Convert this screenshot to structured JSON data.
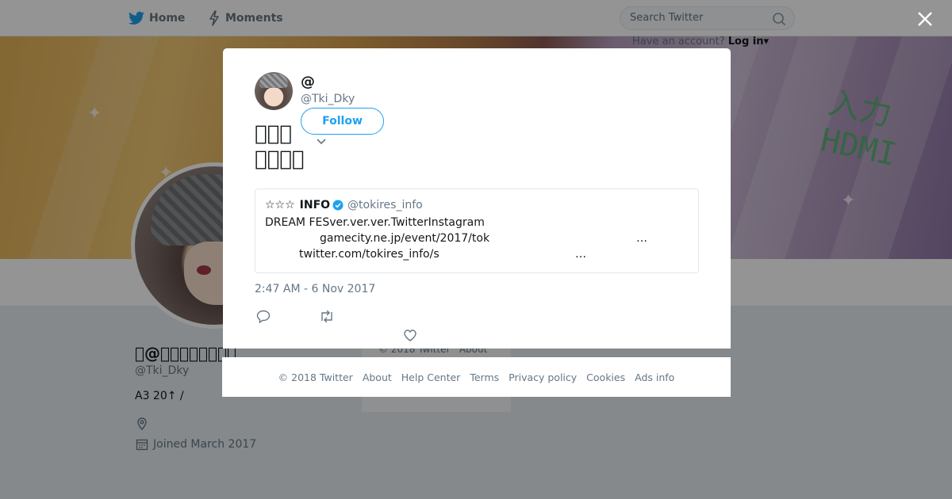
{
  "nav": {
    "home_label": "Home",
    "moments_label": "Moments",
    "search_placeholder": "Search Twitter",
    "login_hint": "Have an account?",
    "login_label": "Log in"
  },
  "banner": {
    "text": "入力\nHDMI"
  },
  "profile": {
    "name": "\u0000@\u0000\u0000\u0000\u0000\u0000\u0000\u0000\u0000",
    "handle": "@Tki_Dky",
    "bio": "A3 20↑ /",
    "joined": "Joined March 2017"
  },
  "sidebar": {
    "footer_copyright": "© 2018 Twitter",
    "footer_about": "About"
  },
  "tweet": {
    "display_name": "@",
    "handle": "@Tki_Dky",
    "follow_label": "Follow",
    "text_line1": "\u0000\u0000\u0000",
    "text_line2": "\u0000\u0000\u0000\u0000",
    "timestamp": "2:47 AM - 6 Nov 2017"
  },
  "quoted": {
    "stars": "☆☆☆",
    "name": "INFO",
    "handle": "@tokires_info",
    "line1": "DREAM FESver.ver.ver.TwitterInstagram",
    "line2": "gamecity.ne.jp/event/2017/tok",
    "line2_ellipsis": "…",
    "line3": "twitter.com/tokires_info/s",
    "line3_ellipsis": "…"
  },
  "footer": {
    "copyright": "© 2018 Twitter",
    "about": "About",
    "help": "Help Center",
    "terms": "Terms",
    "privacy": "Privacy policy",
    "cookies": "Cookies",
    "ads": "Ads info"
  },
  "colors": {
    "accent": "#1da1f2",
    "muted": "#657786"
  },
  "icons": [
    "twitter-bird-icon",
    "lightning-icon",
    "search-icon",
    "close-icon",
    "chevron-down-icon",
    "verified-icon",
    "reply-icon",
    "retweet-icon",
    "like-icon",
    "location-icon",
    "calendar-icon"
  ]
}
